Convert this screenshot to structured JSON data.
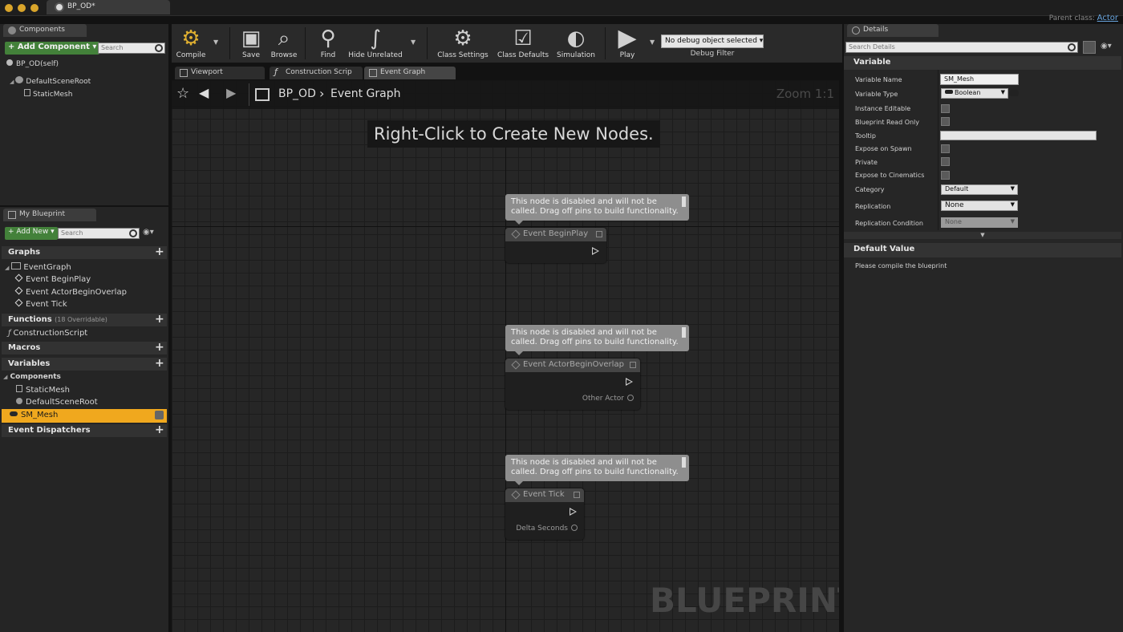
{
  "window": {
    "tab_title": "BP_OD*",
    "parent_class_label": "Parent class:",
    "parent_class_value": "Actor"
  },
  "components_panel": {
    "tab": "Components",
    "add_button": "+ Add Component ▾",
    "search_placeholder": "Search",
    "self_item": "BP_OD(self)",
    "tree": [
      "DefaultSceneRoot",
      "StaticMesh"
    ]
  },
  "my_blueprint": {
    "tab": "My Blueprint",
    "add_new": "+ Add New ▾",
    "search_placeholder": "Search",
    "graphs_header": "Graphs",
    "event_graph": "EventGraph",
    "events": [
      "Event BeginPlay",
      "Event ActorBeginOverlap",
      "Event Tick"
    ],
    "functions_header": "Functions",
    "functions_count": "(18 Overridable)",
    "construction_script": "ConstructionScript",
    "macros_header": "Macros",
    "variables_header": "Variables",
    "components_group": "Components",
    "variable_components": [
      "StaticMesh",
      "DefaultSceneRoot"
    ],
    "selected_variable": "SM_Mesh",
    "dispatchers_header": "Event Dispatchers"
  },
  "toolbar": {
    "compile": "Compile",
    "save": "Save",
    "browse": "Browse",
    "find": "Find",
    "hide_unrelated": "Hide Unrelated",
    "class_settings": "Class Settings",
    "class_defaults": "Class Defaults",
    "simulation": "Simulation",
    "play": "Play",
    "debug_object": "No debug object selected ▾",
    "debug_filter": "Debug Filter"
  },
  "editor_tabs": [
    "Viewport",
    "Construction Scrip",
    "Event Graph"
  ],
  "graph": {
    "breadcrumb_root": "BP_OD",
    "breadcrumb_sep": "›",
    "breadcrumb_current": "Event Graph",
    "zoom": "Zoom 1:1",
    "hint": "Right-Click to Create New Nodes.",
    "watermark": "BLUEPRINT",
    "disabled_comment": "This node is disabled and will not be called. Drag off pins to build functionality.",
    "nodes": [
      {
        "title": "Event BeginPlay",
        "pin": ""
      },
      {
        "title": "Event ActorBeginOverlap",
        "pin": "Other Actor"
      },
      {
        "title": "Event Tick",
        "pin": "Delta Seconds"
      }
    ]
  },
  "details": {
    "tab": "Details",
    "search_placeholder": "Search Details",
    "variable_section": "Variable",
    "labels": {
      "variable_name": "Variable Name",
      "variable_type": "Variable Type",
      "instance_editable": "Instance Editable",
      "blueprint_read_only": "Blueprint Read Only",
      "tooltip": "Tooltip",
      "expose_on_spawn": "Expose on Spawn",
      "private": "Private",
      "expose_to_cinematics": "Expose to Cinematics",
      "category": "Category",
      "replication": "Replication",
      "replication_condition": "Replication Condition"
    },
    "values": {
      "variable_name": "SM_Mesh",
      "variable_type": "Boolean",
      "category": "Default",
      "replication": "None",
      "replication_condition": "None"
    },
    "default_value_section": "Default Value",
    "compile_note": "Please compile the blueprint"
  },
  "colors": {
    "accent_orange": "#f0a81e",
    "green_button": "#43813a",
    "comment_grey": "#8e8e8e"
  }
}
